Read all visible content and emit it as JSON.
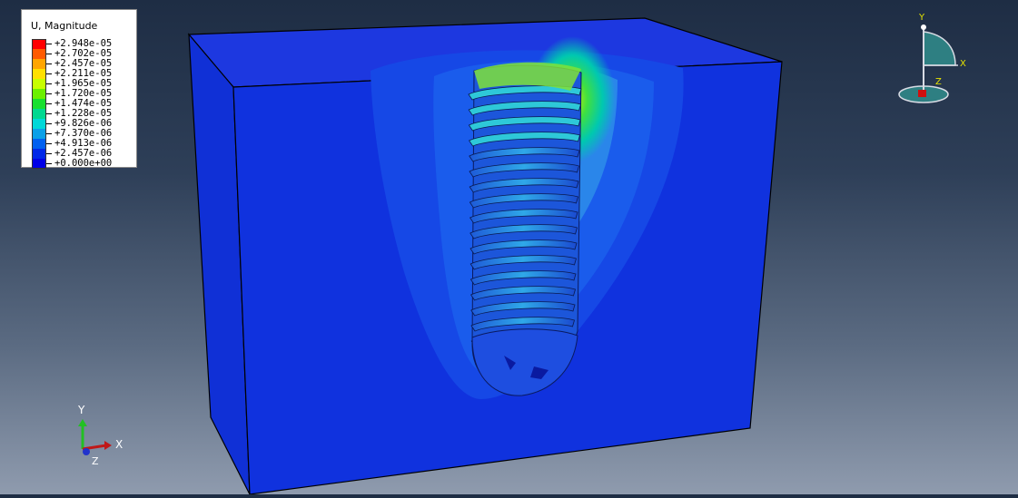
{
  "legend": {
    "title": "U, Magnitude",
    "values": [
      "+2.948e-05",
      "+2.702e-05",
      "+2.457e-05",
      "+2.211e-05",
      "+1.965e-05",
      "+1.720e-05",
      "+1.474e-05",
      "+1.228e-05",
      "+9.826e-06",
      "+7.370e-06",
      "+4.913e-06",
      "+2.457e-06",
      "+0.000e+00"
    ],
    "colors": [
      "#ff0000",
      "#ff5a00",
      "#ffa500",
      "#ffe000",
      "#c8ff00",
      "#6cf000",
      "#18e030",
      "#00d890",
      "#00d8d8",
      "#0aa0e8",
      "#0060f0",
      "#0028e8",
      "#0000e6"
    ]
  },
  "triad": {
    "x": "X",
    "y": "Y",
    "z": "Z"
  },
  "compass": {
    "x": "X",
    "y": "Y",
    "z": "Z"
  }
}
